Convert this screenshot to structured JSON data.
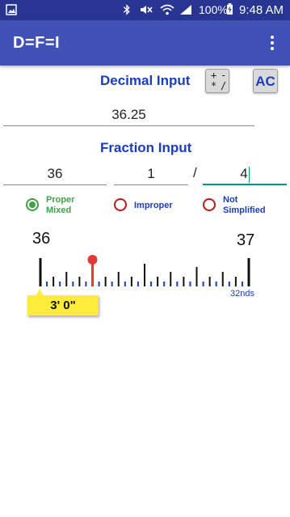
{
  "status_bar": {
    "battery_pct": "100%",
    "time": "9:48 AM",
    "icons": [
      "gallery-icon",
      "bluetooth-icon",
      "mute-icon",
      "wifi-icon",
      "signal-icon",
      "battery-charging-icon"
    ]
  },
  "app_bar": {
    "title": "D=F=I"
  },
  "decimal": {
    "label": "Decimal Input",
    "value": "36.25",
    "ops": [
      "+",
      "-",
      "*",
      "/"
    ],
    "ac_label": "AC"
  },
  "fraction": {
    "label": "Fraction Input",
    "whole": "36",
    "numerator": "1",
    "slash": "/",
    "denominator": "4"
  },
  "modes": [
    {
      "label_line1": "Proper",
      "label_line2": "Mixed",
      "color": "#43a047",
      "checked": true
    },
    {
      "label_line1": "Improper",
      "label_line2": "",
      "color": "#1a3dbd",
      "checked": false
    },
    {
      "label_line1": "Not",
      "label_line2": "Simplified",
      "color": "#1a3dbd",
      "checked": false
    }
  ],
  "ruler": {
    "start_label": "36",
    "end_label": "37",
    "unit_label": "32nds",
    "marker_fraction": 0.25,
    "divisions": 32,
    "feet_inches": "3' 0\""
  }
}
